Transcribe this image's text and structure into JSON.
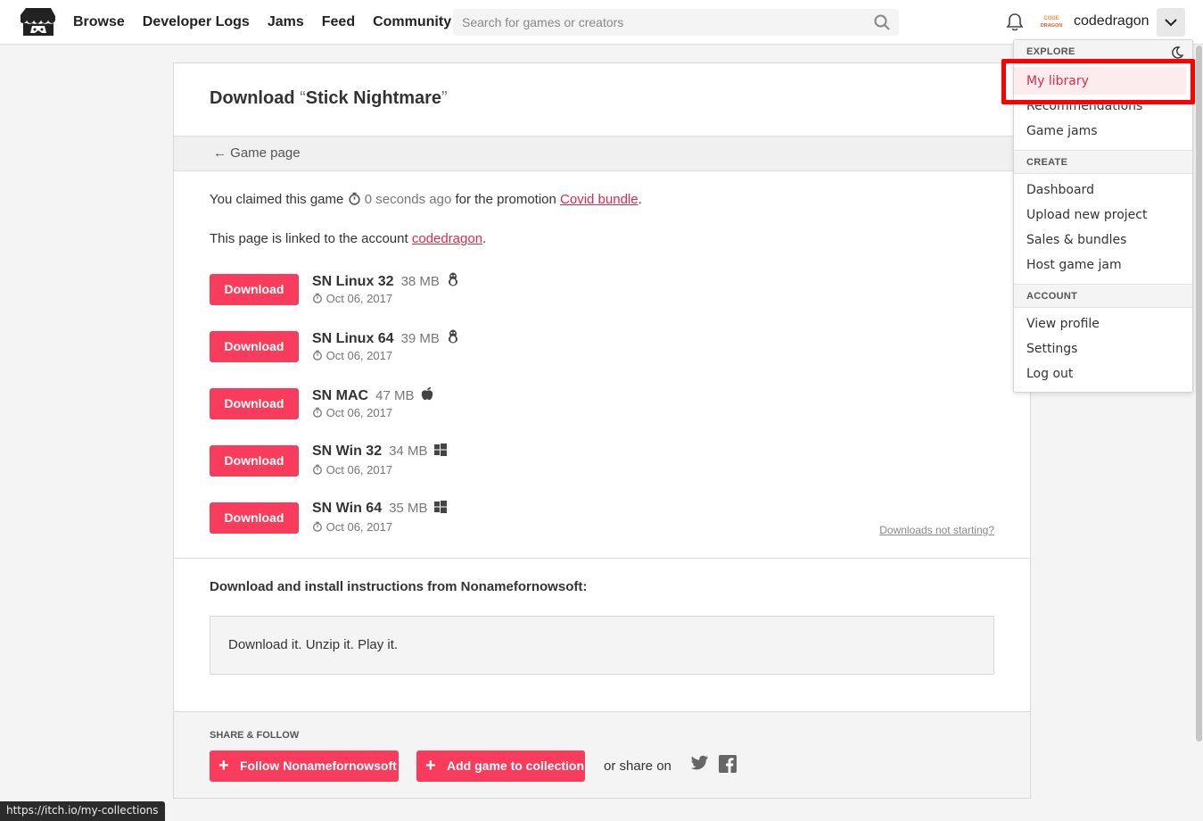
{
  "header": {
    "nav": [
      "Browse",
      "Developer Logs",
      "Jams",
      "Feed",
      "Community"
    ],
    "search_placeholder": "Search for games or creators",
    "username": "codedragon",
    "avatar_text": "CODE DRAGON"
  },
  "page": {
    "title_prefix": "Download ",
    "title_open_quote": "“",
    "title_game": "Stick Nightmare",
    "title_close_quote": "”",
    "back_label": "← Game page",
    "claim_prefix": "You claimed this game ",
    "claim_time": "0 seconds ago",
    "claim_mid": " for the promotion ",
    "claim_promo": "Covid bundle",
    "claim_end": ".",
    "linked_prefix": "This page is linked to the account ",
    "linked_account": "codedragon",
    "linked_end": ".",
    "download_label": "Download",
    "uploads": [
      {
        "name": "SN Linux 32",
        "size": "38 MB",
        "platform": "linux-icon",
        "date": "Oct 06, 2017"
      },
      {
        "name": "SN Linux 64",
        "size": "39 MB",
        "platform": "linux-icon",
        "date": "Oct 06, 2017"
      },
      {
        "name": "SN MAC",
        "size": "47 MB",
        "platform": "apple-icon",
        "date": "Oct 06, 2017"
      },
      {
        "name": "SN Win 32",
        "size": "34 MB",
        "platform": "windows-icon",
        "date": "Oct 06, 2017"
      },
      {
        "name": "SN Win 64",
        "size": "35 MB",
        "platform": "windows-icon",
        "date": "Oct 06, 2017"
      }
    ],
    "not_starting": "Downloads not starting?",
    "instructions_title": "Download and install instructions from Nonamefornowsoft:",
    "instructions_text": "Download it. Unzip it. Play it.",
    "share_label": "SHARE & FOLLOW",
    "follow_label": "Follow Nonamefornowsoft",
    "collection_label": "Add game to collection",
    "or_share": "or share on"
  },
  "dropdown": {
    "explore": "EXPLORE",
    "explore_items": [
      "My library",
      "Recommendations",
      "Game jams"
    ],
    "create": "CREATE",
    "create_items": [
      "Dashboard",
      "Upload new project",
      "Sales & bundles",
      "Host game jam"
    ],
    "account": "ACCOUNT",
    "account_items": [
      "View profile",
      "Settings",
      "Log out"
    ]
  },
  "status_url": "https://itch.io/my-collections",
  "colors": {
    "accent": "#fa3c5c",
    "link": "#da2c49",
    "highlight": "#ff0000"
  }
}
